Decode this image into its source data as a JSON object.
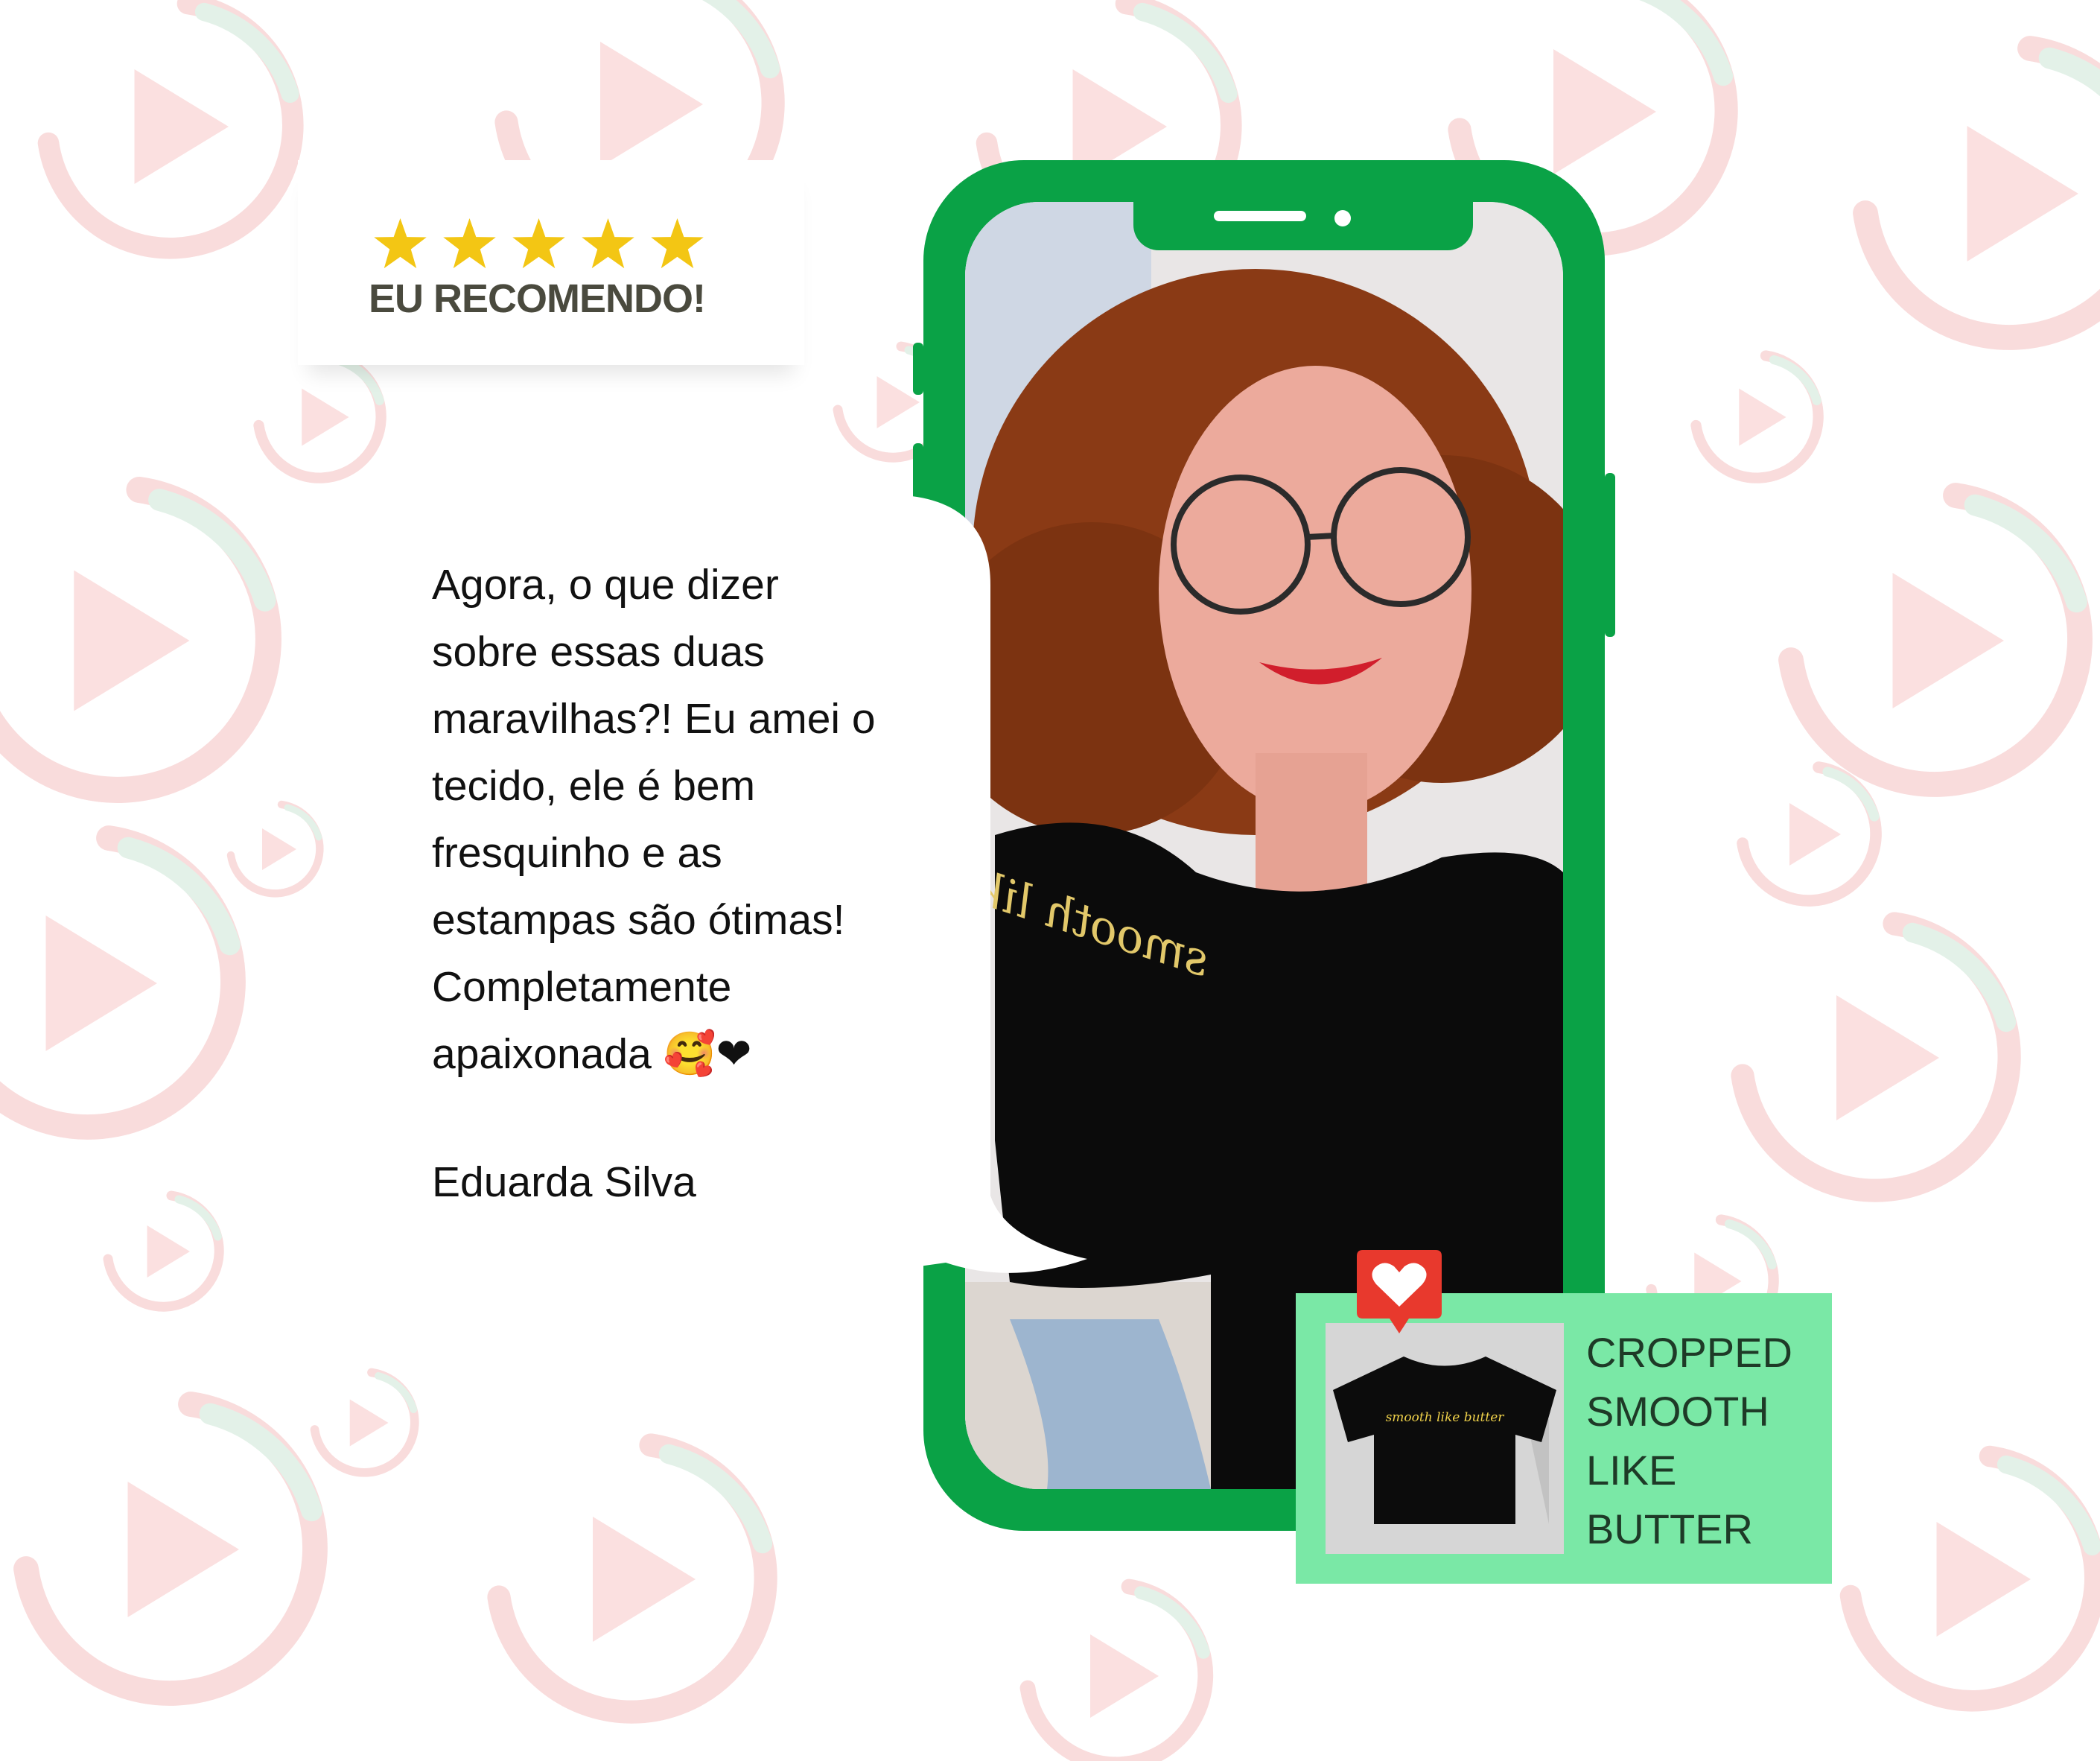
{
  "rating": {
    "stars": 5,
    "label": "EU RECOMENDO!"
  },
  "testimonial": {
    "quote": "Agora, o que dizer\nsobre essas duas\nmaravilhas?! Eu amei o\ntecido, ele é bem\nfresquinho e as\nestampas são ótimas!\nCompletamente\napaixonada 🥰❤",
    "author": "Eduarda Silva"
  },
  "shirt_print": "smooth like butter",
  "product": {
    "title": "CROPPED SMOOTH LIKE BUTTER"
  },
  "colors": {
    "phone_green": "#0aa246",
    "card_green": "#7ae8a6",
    "star_yellow": "#f3c614",
    "heart_red": "#e8392d",
    "pattern_pink": "#f9dede"
  }
}
